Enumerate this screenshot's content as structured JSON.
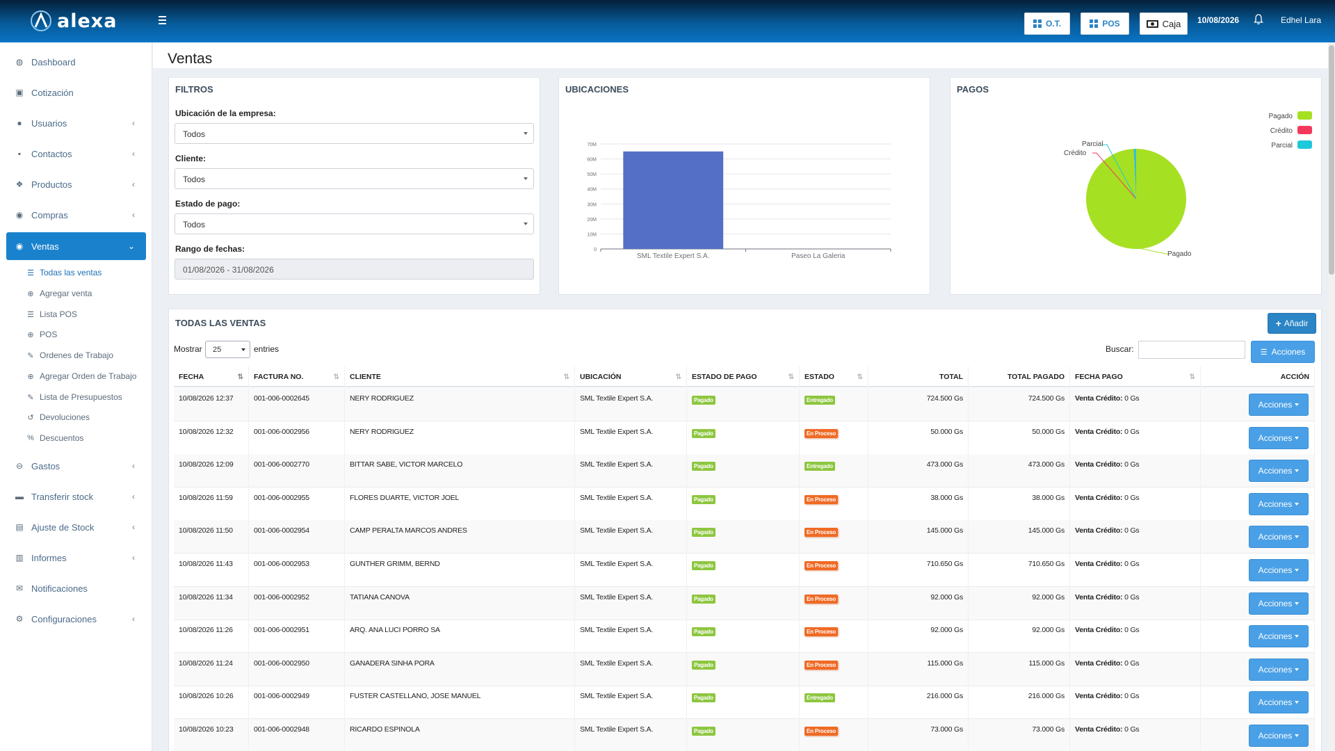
{
  "header": {
    "logo_text": "alexa",
    "btn_ot": "O.T.",
    "btn_pos": "POS",
    "btn_caja": "Caja",
    "date": "10/08/2026",
    "user": "Edhel Lara"
  },
  "sidebar": {
    "items": [
      {
        "label": "Dashboard",
        "icon": "dashboard-icon"
      },
      {
        "label": "Cotización",
        "icon": "money-icon"
      },
      {
        "label": "Usuarios",
        "icon": "users-icon"
      },
      {
        "label": "Contactos",
        "icon": "address-book-icon"
      },
      {
        "label": "Productos",
        "icon": "cubes-icon"
      },
      {
        "label": "Compras",
        "icon": "arrow-circle-icon"
      },
      {
        "label": "Ventas",
        "icon": "arrow-circle-up-icon"
      },
      {
        "label": "Gastos",
        "icon": "minus-circle-icon"
      },
      {
        "label": "Transferir stock",
        "icon": "truck-icon"
      },
      {
        "label": "Ajuste de Stock",
        "icon": "database-icon"
      },
      {
        "label": "Informes",
        "icon": "bar-chart-icon"
      },
      {
        "label": "Notificaciones",
        "icon": "envelope-icon"
      },
      {
        "label": "Configuraciones",
        "icon": "cog-icon"
      }
    ],
    "sub_items": [
      {
        "label": "Todas las ventas",
        "icon": "list-icon"
      },
      {
        "label": "Agregar venta",
        "icon": "plus-circle-icon"
      },
      {
        "label": "Lista POS",
        "icon": "list-icon"
      },
      {
        "label": "POS",
        "icon": "plus-circle-icon"
      },
      {
        "label": "Ordenes de Trabajo",
        "icon": "edit-icon"
      },
      {
        "label": "Agregar Orden de Trabajo",
        "icon": "plus-circle-icon"
      },
      {
        "label": "Lista de Presupuestos",
        "icon": "edit-icon"
      },
      {
        "label": "Devoluciones",
        "icon": "undo-icon"
      },
      {
        "label": "Descuentos",
        "icon": "percent-icon"
      }
    ]
  },
  "page": {
    "title": "Ventas"
  },
  "filters": {
    "title": "FILTROS",
    "location_label": "Ubicación de la empresa:",
    "location_value": "Todos",
    "client_label": "Cliente:",
    "client_value": "Todos",
    "payment_label": "Estado de pago:",
    "payment_value": "Todos",
    "range_label": "Rango de fechas:",
    "range_value": "01/08/2026 - 31/08/2026"
  },
  "ubicaciones": {
    "title": "UBICACIONES"
  },
  "pagos": {
    "title": "PAGOS"
  },
  "chart_data": [
    {
      "type": "bar",
      "categories": [
        "SML Textile Expert S.A.",
        "Paseo La Galeria"
      ],
      "values": [
        65000000,
        0
      ],
      "yticks": [
        "0",
        "10M",
        "20M",
        "30M",
        "40M",
        "50M",
        "60M",
        "70M"
      ],
      "ylim": [
        0,
        70000000
      ],
      "color": "#5470c6",
      "grid": true
    },
    {
      "type": "pie",
      "labels": [
        "Pagado",
        "Crédito",
        "Parcial"
      ],
      "values": [
        99.2,
        0.1,
        0.7
      ],
      "colors": [
        "#a6e022",
        "#f2395b",
        "#1fc8db"
      ],
      "legend": "top-right"
    }
  ],
  "table": {
    "title": "TODAS LAS VENTAS",
    "add_label": "Añadir",
    "show_label": "Mostrar",
    "entries_value": "25",
    "entries_label": "entries",
    "search_label": "Buscar:",
    "actions_label": "Acciones",
    "columns": [
      "FECHA",
      "FACTURA NO.",
      "CLIENTE",
      "UBICACIÓN",
      "ESTADO DE PAGO",
      "ESTADO",
      "TOTAL",
      "TOTAL PAGADO",
      "FECHA PAGO",
      "ACCIÓN"
    ],
    "credit_prefix": "Venta Crédito:",
    "rows": [
      {
        "fecha": "10/08/2026 12:37",
        "factura": "001-006-0002645",
        "cliente": "NERY RODRIGUEZ",
        "ubicacion": "SML Textile Expert S.A.",
        "pago": "Pagado",
        "estado": "Entregado",
        "total": "724.500 Gs",
        "pagado": "724.500 Gs",
        "credito": "0 Gs",
        "accion": "Acciones"
      },
      {
        "fecha": "10/08/2026 12:32",
        "factura": "001-006-0002956",
        "cliente": "NERY RODRIGUEZ",
        "ubicacion": "SML Textile Expert S.A.",
        "pago": "Pagado",
        "estado": "En Proceso",
        "total": "50.000 Gs",
        "pagado": "50.000 Gs",
        "credito": "0 Gs",
        "accion": "Acciones"
      },
      {
        "fecha": "10/08/2026 12:09",
        "factura": "001-006-0002770",
        "cliente": "BITTAR SABE, VICTOR MARCELO",
        "ubicacion": "SML Textile Expert S.A.",
        "pago": "Pagado",
        "estado": "Entregado",
        "total": "473.000 Gs",
        "pagado": "473.000 Gs",
        "credito": "0 Gs",
        "accion": "Acciones"
      },
      {
        "fecha": "10/08/2026 11:59",
        "factura": "001-006-0002955",
        "cliente": "FLORES DUARTE, VICTOR JOEL",
        "ubicacion": "SML Textile Expert S.A.",
        "pago": "Pagado",
        "estado": "En Proceso",
        "total": "38.000 Gs",
        "pagado": "38.000 Gs",
        "credito": "0 Gs",
        "accion": "Acciones"
      },
      {
        "fecha": "10/08/2026 11:50",
        "factura": "001-006-0002954",
        "cliente": "CAMP PERALTA MARCOS ANDRES",
        "ubicacion": "SML Textile Expert S.A.",
        "pago": "Pagado",
        "estado": "En Proceso",
        "total": "145.000 Gs",
        "pagado": "145.000 Gs",
        "credito": "0 Gs",
        "accion": "Acciones"
      },
      {
        "fecha": "10/08/2026 11:43",
        "factura": "001-006-0002953",
        "cliente": "GUNTHER GRIMM, BERND",
        "ubicacion": "SML Textile Expert S.A.",
        "pago": "Pagado",
        "estado": "En Proceso",
        "total": "710.650 Gs",
        "pagado": "710.650 Gs",
        "credito": "0 Gs",
        "accion": "Acciones"
      },
      {
        "fecha": "10/08/2026 11:34",
        "factura": "001-006-0002952",
        "cliente": "TATIANA CANOVA",
        "ubicacion": "SML Textile Expert S.A.",
        "pago": "Pagado",
        "estado": "En Proceso",
        "total": "92.000 Gs",
        "pagado": "92.000 Gs",
        "credito": "0 Gs",
        "accion": "Acciones"
      },
      {
        "fecha": "10/08/2026 11:26",
        "factura": "001-006-0002951",
        "cliente": "ARQ. ANA LUCI PORRO SA",
        "ubicacion": "SML Textile Expert S.A.",
        "pago": "Pagado",
        "estado": "En Proceso",
        "total": "92.000 Gs",
        "pagado": "92.000 Gs",
        "credito": "0 Gs",
        "accion": "Acciones"
      },
      {
        "fecha": "10/08/2026 11:24",
        "factura": "001-006-0002950",
        "cliente": "GANADERA SINHA PORA",
        "ubicacion": "SML Textile Expert S.A.",
        "pago": "Pagado",
        "estado": "En Proceso",
        "total": "115.000 Gs",
        "pagado": "115.000 Gs",
        "credito": "0 Gs",
        "accion": "Acciones"
      },
      {
        "fecha": "10/08/2026 10:26",
        "factura": "001-006-0002949",
        "cliente": "FUSTER CASTELLANO, JOSE MANUEL",
        "ubicacion": "SML Textile Expert S.A.",
        "pago": "Pagado",
        "estado": "Entregado",
        "total": "216.000 Gs",
        "pagado": "216.000 Gs",
        "credito": "0 Gs",
        "accion": "Acciones"
      },
      {
        "fecha": "10/08/2026 10:23",
        "factura": "001-006-0002948",
        "cliente": "RICARDO ESPINOLA",
        "ubicacion": "SML Textile Expert S.A.",
        "pago": "Pagado",
        "estado": "En Proceso",
        "total": "73.000 Gs",
        "pagado": "73.000 Gs",
        "credito": "0 Gs",
        "accion": "Acciones"
      }
    ]
  }
}
